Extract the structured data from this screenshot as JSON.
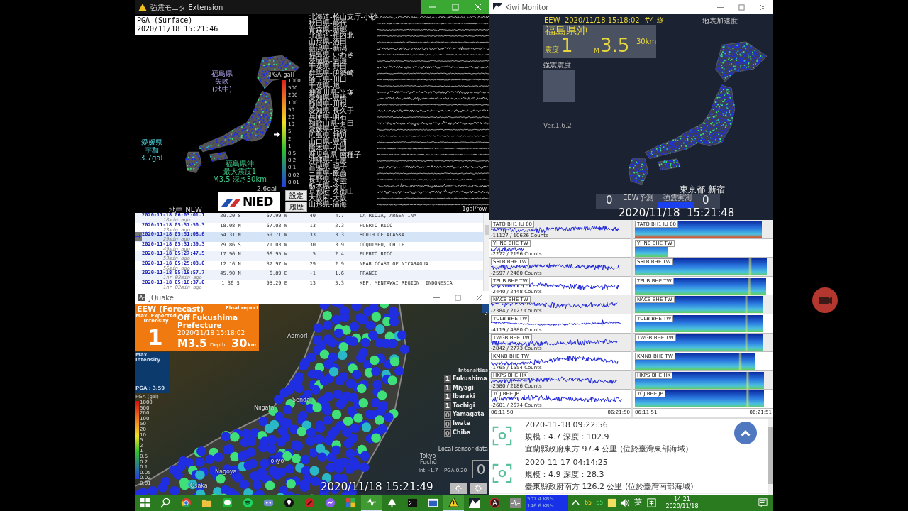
{
  "monitor_window": {
    "title": "強震モニタ Extension",
    "pga_box": {
      "title": "PGA (Surface)",
      "time": "2020/11/18 15:21:46"
    },
    "map_labels": [
      {
        "kind": "station",
        "lines": [
          "福島県",
          "矢吹",
          "(地中)"
        ]
      },
      {
        "kind": "peak",
        "lines": [
          "愛媛県",
          "宇和",
          "3.7gal"
        ]
      },
      {
        "kind": "quake",
        "lines": [
          "福島県沖",
          "最大震度1",
          "M3.5 深さ30km"
        ]
      }
    ],
    "scale": {
      "title": "PGA[gal]",
      "ticks": [
        "1000",
        "500",
        "200",
        "100",
        "50",
        "20",
        "10",
        "5",
        "2",
        "1",
        "0.5",
        "0.2",
        "0.1",
        "0.02",
        "0.01"
      ]
    },
    "scale_reading": "2.6gal",
    "logo_text": "NIED",
    "buttons": [
      "設定",
      "履歴"
    ],
    "mode_label": "地中 NEW",
    "stations": [
      "北海道-桧山支庁-小砂",
      "秋田県-能代",
      "青森県-新郷",
      "北海道-稚内北",
      "山形県-酒田",
      "新潟県-新潟",
      "福島県-いわき",
      "茨城県-岩瀬",
      "千葉県-野田",
      "群馬県-伊勢崎",
      "埼玉県-川口",
      "千葉県-旭",
      "神奈川県-平塚",
      "愛知県-豊橋",
      "静岡県-川根",
      "愛知県-長久手",
      "兵庫県-明石",
      "和歌山県-有田",
      "愛媛県-長浜",
      "広島県-神辺",
      "山口県-豊浦",
      "熊本県-小国",
      "鹿児島県-南種子",
      "沖縄県-上原",
      "宮城県-鳴子",
      "三重県-飯高",
      "長野県-安曇",
      "栃木県-今市",
      "京都府-久御山",
      "大阪府-大阪",
      "山形県-温海"
    ],
    "row_scale": "1gal/row"
  },
  "quake_table": {
    "rows": [
      {
        "time": "2020-11-18 06:03:01.1",
        "ago": "18min ago",
        "lat": "29.20 S",
        "lon": "67.99 W",
        "depth": "40",
        "mag": "4.7",
        "region": "LA RIOJA, ARGENTINA",
        "selected": false
      },
      {
        "time": "2020-11-18 05:57:50.3",
        "ago": "23min ago",
        "lat": "18.08 N",
        "lon": "67.03 W",
        "depth": "13",
        "mag": "2.3",
        "region": "PUERTO RICO",
        "selected": false
      },
      {
        "time": "2020-11-18 05:51:08.6",
        "ago": "29min ago",
        "lat": "54.31 N",
        "lon": "159.71 W",
        "depth": "33",
        "mag": "3.3",
        "region": "SOUTH OF ALASKA",
        "selected": true
      },
      {
        "time": "2020-11-18 05:31:39.3",
        "ago": "49min ago",
        "lat": "29.86 S",
        "lon": "71.03 W",
        "depth": "30",
        "mag": "3.9",
        "region": "COQUIMBO, CHILE",
        "selected": false
      },
      {
        "time": "2020-11-18 05:27:47.5",
        "ago": "53min ago",
        "lat": "17.96 N",
        "lon": "66.95 W",
        "depth": "5",
        "mag": "2.4",
        "region": "PUERTO RICO",
        "selected": false
      },
      {
        "time": "2020-11-18 05:25:03.0",
        "ago": "56min ago",
        "lat": "12.16 N",
        "lon": "87.97 W",
        "depth": "29",
        "mag": "2.9",
        "region": "NEAR COAST OF NICARAGUA",
        "selected": false
      },
      {
        "time": "2020-11-18 05:18:57.7",
        "ago": "1hr 02min ago",
        "lat": "45.90 N",
        "lon": "6.89 E",
        "depth": "-1",
        "mag": "1.6",
        "region": "FRANCE",
        "selected": false
      },
      {
        "time": "2020-11-18 05:18:37.0",
        "ago": "1hr 02min ago",
        "lat": "1.36 S",
        "lon": "98.29 E",
        "depth": "13",
        "mag": "3.3",
        "region": "KEP. MENTAWAI REGION, INDONESIA",
        "selected": false
      }
    ]
  },
  "jquake": {
    "title": "JQuake",
    "eew": {
      "heading": "EEW (Forecast)",
      "status": "Final report",
      "intensity_label": "Max. Expected Intensity",
      "intensity": "1",
      "region": "Off Fukushima Prefecture",
      "time": "2020/11/18 15:18:02",
      "magnitude": "M3.5",
      "depth_label": "Depth:",
      "depth": "30",
      "depth_unit": "km"
    },
    "max_intensity": {
      "label": "Max. Intensity",
      "pga": "PGA : 3.59"
    },
    "pga_scale": {
      "title": "PGA (gal)",
      "ticks": [
        "1000",
        "500",
        "200",
        "100",
        "50",
        "20",
        "10",
        "5",
        "2",
        "1",
        "0.5",
        "0.2",
        "0.1",
        "0.05",
        "0.02",
        "0.01"
      ]
    },
    "cities": [
      "Aomori",
      "Sendai",
      "Niigata",
      "Tokyo",
      "Nagoya",
      "Osaka"
    ],
    "intensities": {
      "title": "Intensities",
      "items": [
        {
          "value": "1",
          "name": "Fukushima",
          "lit": true
        },
        {
          "value": "1",
          "name": "Miyagi",
          "lit": true
        },
        {
          "value": "1",
          "name": "Ibaraki",
          "lit": true
        },
        {
          "value": "1",
          "name": "Tochigi",
          "lit": true
        },
        {
          "value": "0",
          "name": "Yamagata",
          "lit": false
        },
        {
          "value": "0",
          "name": "Iwate",
          "lit": false
        },
        {
          "value": "0",
          "name": "Chiba",
          "lit": false
        }
      ]
    },
    "local_sensor": {
      "title": "Local sensor data",
      "place": "Tokyo",
      "subplace": "Fuchū",
      "int": "Int. -1.7",
      "pga": "PGA 0.20",
      "value": "0"
    },
    "clock": "2020/11/18 15:21:49"
  },
  "kiwi": {
    "title": "Kiwi Monitor",
    "eew_line": "EEW  2020/11/18 15:18:02  #4 終",
    "layer": "地表加速度",
    "region": "福島県沖",
    "intensity_label": "震度",
    "intensity": "1",
    "mag_label": "M",
    "magnitude": "3.5",
    "depth": "30km",
    "strong_label": "強震震度",
    "version": "Ver.1.6.2",
    "place": "東京都 新宿",
    "forecast_value": "0",
    "forecast_label": "EEW予測",
    "measured_label": "強震実測",
    "measured_value": "0",
    "time": "2020/11/18  15:21:48"
  },
  "seismograms": {
    "stations": [
      {
        "name": "TATO BH1 IU 00",
        "counts": "-11127 / 10626 Counts"
      },
      {
        "name": "YHNB BHE TW",
        "counts": "-2272 / 2196 Counts"
      },
      {
        "name": "SSLB BHE TW",
        "counts": "-2597 / 2460 Counts"
      },
      {
        "name": "TPUB BHE TW",
        "counts": "-2440 / 2448 Counts"
      },
      {
        "name": "NACB BHE TW",
        "counts": "-2384 / 2127 Counts"
      },
      {
        "name": "YULB BHE TW",
        "counts": "-4119 / 4880 Counts"
      },
      {
        "name": "TWGB BHE TW",
        "counts": "-2842 / 2773 Counts"
      },
      {
        "name": "KMNB BHE TW",
        "counts": "-1765 / 1554 Counts"
      },
      {
        "name": "HKPS BHE HK",
        "counts": "-2580 / 2186 Counts"
      },
      {
        "name": "YOJ BHE JP",
        "counts": "-2601 / 2674 Counts"
      }
    ],
    "start": "06:11:50",
    "end": "06:21:50"
  },
  "spectrograms": {
    "stations": [
      "TATO BH1 IU 00",
      "YHNB BHE TW",
      "SSLB BHE TW",
      "TPUB BHE TW",
      "NACB BHE TW",
      "YULB BHE TW",
      "TWGB BHE TW",
      "KMNB BHE TW",
      "HKPS BHE HK",
      "YOJ BHE JP"
    ],
    "start": "06:11:51",
    "end": "06:21:51"
  },
  "quake_list": [
    {
      "time": "2020-11-18 09:22:56",
      "scale": "規模：4.7 深度：102.9",
      "location": "宜蘭縣政府東方 97.4 公里 (位於臺灣東部海域)"
    },
    {
      "time": "2020-11-17 04:14:25",
      "scale": "規模：4.9 深度：28.3",
      "location": "臺東縣政府南方 126.2 公里 (位於臺灣南部海域)"
    }
  ],
  "taskbar": {
    "apps": [
      {
        "kind": "browser",
        "active": false
      },
      {
        "kind": "folder",
        "active": false
      },
      {
        "kind": "chat",
        "active": false
      },
      {
        "kind": "music",
        "active": false
      },
      {
        "kind": "gamepad",
        "active": false
      },
      {
        "kind": "pin",
        "active": false
      },
      {
        "kind": "pen",
        "active": false
      },
      {
        "kind": "messenger",
        "active": false
      },
      {
        "kind": "tiles",
        "active": false
      },
      {
        "kind": "wave",
        "active": true
      },
      {
        "kind": "tree",
        "active": false
      },
      {
        "kind": "terminal",
        "active": false
      },
      {
        "kind": "window",
        "active": false
      },
      {
        "kind": "warning",
        "active": true
      },
      {
        "kind": "mountain",
        "active": false
      },
      {
        "kind": "letter",
        "active": false
      },
      {
        "kind": "pulse",
        "active": false
      }
    ],
    "upload": "507.4 KB/s",
    "download": "146.6 KB/s",
    "tray_values": [
      "65",
      "65"
    ],
    "ime": "英",
    "clock_time": "14:21",
    "clock_date": "2020/11/18"
  }
}
